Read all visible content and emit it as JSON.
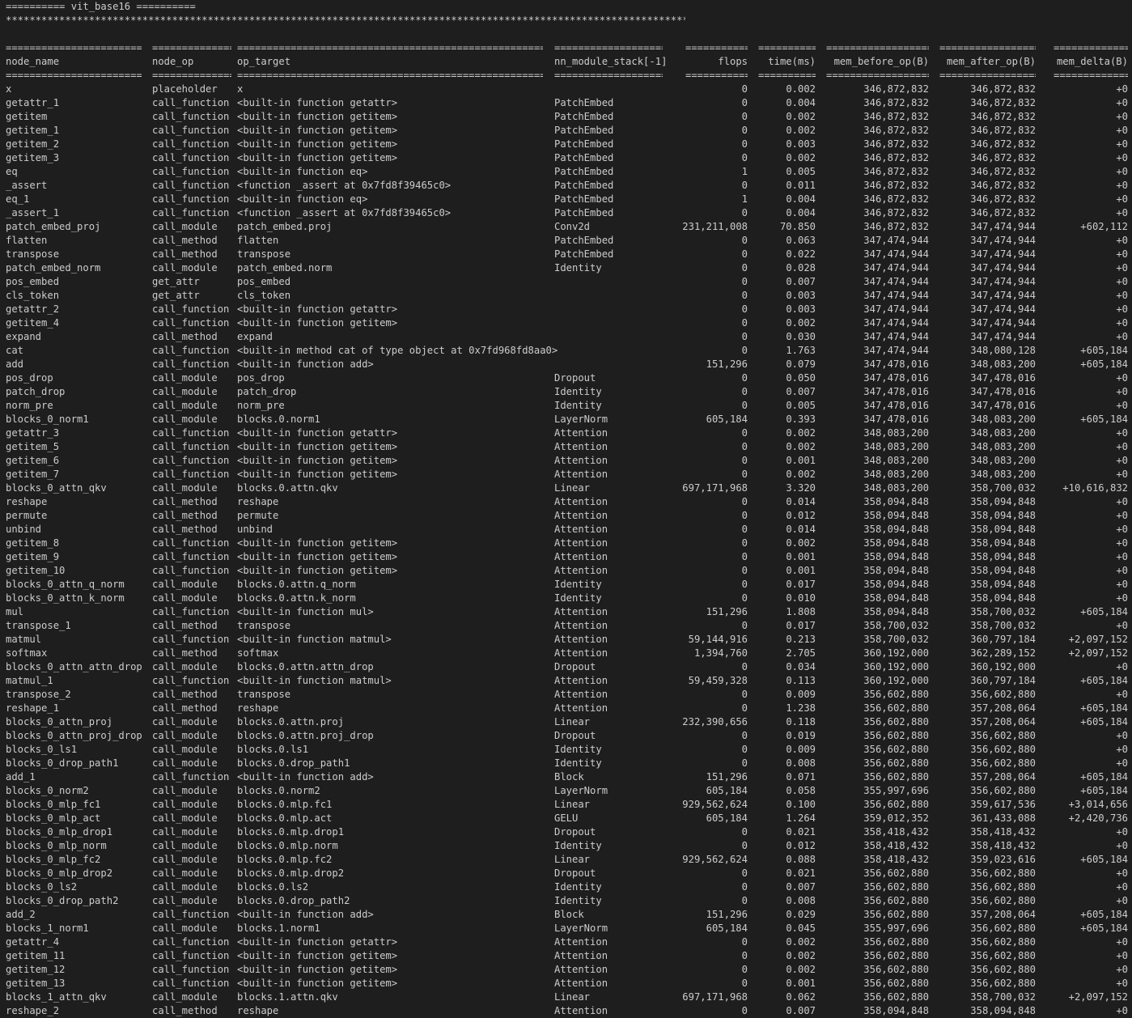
{
  "terminal": {
    "banner": "========== vit_base16 ==========",
    "stars": "*****************************************************************************************************************************************************************************************************"
  },
  "table": {
    "columns": [
      "node_name",
      "node_op",
      "op_target",
      "nn_module_stack[-1]",
      "flops",
      "time(ms)",
      "mem_before_op(B)",
      "mem_after_op(B)",
      "mem_delta(B)"
    ],
    "rows": [
      [
        "x",
        "placeholder",
        "x",
        "",
        "0",
        "0.002",
        "346,872,832",
        "346,872,832",
        "+0"
      ],
      [
        "getattr_1",
        "call_function",
        "<built-in function getattr>",
        "PatchEmbed",
        "0",
        "0.004",
        "346,872,832",
        "346,872,832",
        "+0"
      ],
      [
        "getitem",
        "call_function",
        "<built-in function getitem>",
        "PatchEmbed",
        "0",
        "0.002",
        "346,872,832",
        "346,872,832",
        "+0"
      ],
      [
        "getitem_1",
        "call_function",
        "<built-in function getitem>",
        "PatchEmbed",
        "0",
        "0.002",
        "346,872,832",
        "346,872,832",
        "+0"
      ],
      [
        "getitem_2",
        "call_function",
        "<built-in function getitem>",
        "PatchEmbed",
        "0",
        "0.003",
        "346,872,832",
        "346,872,832",
        "+0"
      ],
      [
        "getitem_3",
        "call_function",
        "<built-in function getitem>",
        "PatchEmbed",
        "0",
        "0.002",
        "346,872,832",
        "346,872,832",
        "+0"
      ],
      [
        "eq",
        "call_function",
        "<built-in function eq>",
        "PatchEmbed",
        "1",
        "0.005",
        "346,872,832",
        "346,872,832",
        "+0"
      ],
      [
        "_assert",
        "call_function",
        "<function _assert at 0x7fd8f39465c0>",
        "PatchEmbed",
        "0",
        "0.011",
        "346,872,832",
        "346,872,832",
        "+0"
      ],
      [
        "eq_1",
        "call_function",
        "<built-in function eq>",
        "PatchEmbed",
        "1",
        "0.004",
        "346,872,832",
        "346,872,832",
        "+0"
      ],
      [
        "_assert_1",
        "call_function",
        "<function _assert at 0x7fd8f39465c0>",
        "PatchEmbed",
        "0",
        "0.004",
        "346,872,832",
        "346,872,832",
        "+0"
      ],
      [
        "patch_embed_proj",
        "call_module",
        "patch_embed.proj",
        "Conv2d",
        "231,211,008",
        "70.850",
        "346,872,832",
        "347,474,944",
        "+602,112"
      ],
      [
        "flatten",
        "call_method",
        "flatten",
        "PatchEmbed",
        "0",
        "0.063",
        "347,474,944",
        "347,474,944",
        "+0"
      ],
      [
        "transpose",
        "call_method",
        "transpose",
        "PatchEmbed",
        "0",
        "0.022",
        "347,474,944",
        "347,474,944",
        "+0"
      ],
      [
        "patch_embed_norm",
        "call_module",
        "patch_embed.norm",
        "Identity",
        "0",
        "0.028",
        "347,474,944",
        "347,474,944",
        "+0"
      ],
      [
        "pos_embed",
        "get_attr",
        "pos_embed",
        "",
        "0",
        "0.007",
        "347,474,944",
        "347,474,944",
        "+0"
      ],
      [
        "cls_token",
        "get_attr",
        "cls_token",
        "",
        "0",
        "0.003",
        "347,474,944",
        "347,474,944",
        "+0"
      ],
      [
        "getattr_2",
        "call_function",
        "<built-in function getattr>",
        "",
        "0",
        "0.003",
        "347,474,944",
        "347,474,944",
        "+0"
      ],
      [
        "getitem_4",
        "call_function",
        "<built-in function getitem>",
        "",
        "0",
        "0.002",
        "347,474,944",
        "347,474,944",
        "+0"
      ],
      [
        "expand",
        "call_method",
        "expand",
        "",
        "0",
        "0.030",
        "347,474,944",
        "347,474,944",
        "+0"
      ],
      [
        "cat",
        "call_function",
        "<built-in method cat of type object at 0x7fd968fd8aa0>",
        "",
        "0",
        "1.763",
        "347,474,944",
        "348,080,128",
        "+605,184"
      ],
      [
        "add",
        "call_function",
        "<built-in function add>",
        "",
        "151,296",
        "0.079",
        "347,478,016",
        "348,083,200",
        "+605,184"
      ],
      [
        "pos_drop",
        "call_module",
        "pos_drop",
        "Dropout",
        "0",
        "0.050",
        "347,478,016",
        "347,478,016",
        "+0"
      ],
      [
        "patch_drop",
        "call_module",
        "patch_drop",
        "Identity",
        "0",
        "0.007",
        "347,478,016",
        "347,478,016",
        "+0"
      ],
      [
        "norm_pre",
        "call_module",
        "norm_pre",
        "Identity",
        "0",
        "0.005",
        "347,478,016",
        "347,478,016",
        "+0"
      ],
      [
        "blocks_0_norm1",
        "call_module",
        "blocks.0.norm1",
        "LayerNorm",
        "605,184",
        "0.393",
        "347,478,016",
        "348,083,200",
        "+605,184"
      ],
      [
        "getattr_3",
        "call_function",
        "<built-in function getattr>",
        "Attention",
        "0",
        "0.002",
        "348,083,200",
        "348,083,200",
        "+0"
      ],
      [
        "getitem_5",
        "call_function",
        "<built-in function getitem>",
        "Attention",
        "0",
        "0.002",
        "348,083,200",
        "348,083,200",
        "+0"
      ],
      [
        "getitem_6",
        "call_function",
        "<built-in function getitem>",
        "Attention",
        "0",
        "0.001",
        "348,083,200",
        "348,083,200",
        "+0"
      ],
      [
        "getitem_7",
        "call_function",
        "<built-in function getitem>",
        "Attention",
        "0",
        "0.002",
        "348,083,200",
        "348,083,200",
        "+0"
      ],
      [
        "blocks_0_attn_qkv",
        "call_module",
        "blocks.0.attn.qkv",
        "Linear",
        "697,171,968",
        "3.320",
        "348,083,200",
        "358,700,032",
        "+10,616,832"
      ],
      [
        "reshape",
        "call_method",
        "reshape",
        "Attention",
        "0",
        "0.014",
        "358,094,848",
        "358,094,848",
        "+0"
      ],
      [
        "permute",
        "call_method",
        "permute",
        "Attention",
        "0",
        "0.012",
        "358,094,848",
        "358,094,848",
        "+0"
      ],
      [
        "unbind",
        "call_method",
        "unbind",
        "Attention",
        "0",
        "0.014",
        "358,094,848",
        "358,094,848",
        "+0"
      ],
      [
        "getitem_8",
        "call_function",
        "<built-in function getitem>",
        "Attention",
        "0",
        "0.002",
        "358,094,848",
        "358,094,848",
        "+0"
      ],
      [
        "getitem_9",
        "call_function",
        "<built-in function getitem>",
        "Attention",
        "0",
        "0.001",
        "358,094,848",
        "358,094,848",
        "+0"
      ],
      [
        "getitem_10",
        "call_function",
        "<built-in function getitem>",
        "Attention",
        "0",
        "0.001",
        "358,094,848",
        "358,094,848",
        "+0"
      ],
      [
        "blocks_0_attn_q_norm",
        "call_module",
        "blocks.0.attn.q_norm",
        "Identity",
        "0",
        "0.017",
        "358,094,848",
        "358,094,848",
        "+0"
      ],
      [
        "blocks_0_attn_k_norm",
        "call_module",
        "blocks.0.attn.k_norm",
        "Identity",
        "0",
        "0.010",
        "358,094,848",
        "358,094,848",
        "+0"
      ],
      [
        "mul",
        "call_function",
        "<built-in function mul>",
        "Attention",
        "151,296",
        "1.808",
        "358,094,848",
        "358,700,032",
        "+605,184"
      ],
      [
        "transpose_1",
        "call_method",
        "transpose",
        "Attention",
        "0",
        "0.017",
        "358,700,032",
        "358,700,032",
        "+0"
      ],
      [
        "matmul",
        "call_function",
        "<built-in function matmul>",
        "Attention",
        "59,144,916",
        "0.213",
        "358,700,032",
        "360,797,184",
        "+2,097,152"
      ],
      [
        "softmax",
        "call_method",
        "softmax",
        "Attention",
        "1,394,760",
        "2.705",
        "360,192,000",
        "362,289,152",
        "+2,097,152"
      ],
      [
        "blocks_0_attn_attn_drop",
        "call_module",
        "blocks.0.attn.attn_drop",
        "Dropout",
        "0",
        "0.034",
        "360,192,000",
        "360,192,000",
        "+0"
      ],
      [
        "matmul_1",
        "call_function",
        "<built-in function matmul>",
        "Attention",
        "59,459,328",
        "0.113",
        "360,192,000",
        "360,797,184",
        "+605,184"
      ],
      [
        "transpose_2",
        "call_method",
        "transpose",
        "Attention",
        "0",
        "0.009",
        "356,602,880",
        "356,602,880",
        "+0"
      ],
      [
        "reshape_1",
        "call_method",
        "reshape",
        "Attention",
        "0",
        "1.238",
        "356,602,880",
        "357,208,064",
        "+605,184"
      ],
      [
        "blocks_0_attn_proj",
        "call_module",
        "blocks.0.attn.proj",
        "Linear",
        "232,390,656",
        "0.118",
        "356,602,880",
        "357,208,064",
        "+605,184"
      ],
      [
        "blocks_0_attn_proj_drop",
        "call_module",
        "blocks.0.attn.proj_drop",
        "Dropout",
        "0",
        "0.019",
        "356,602,880",
        "356,602,880",
        "+0"
      ],
      [
        "blocks_0_ls1",
        "call_module",
        "blocks.0.ls1",
        "Identity",
        "0",
        "0.009",
        "356,602,880",
        "356,602,880",
        "+0"
      ],
      [
        "blocks_0_drop_path1",
        "call_module",
        "blocks.0.drop_path1",
        "Identity",
        "0",
        "0.008",
        "356,602,880",
        "356,602,880",
        "+0"
      ],
      [
        "add_1",
        "call_function",
        "<built-in function add>",
        "Block",
        "151,296",
        "0.071",
        "356,602,880",
        "357,208,064",
        "+605,184"
      ],
      [
        "blocks_0_norm2",
        "call_module",
        "blocks.0.norm2",
        "LayerNorm",
        "605,184",
        "0.058",
        "355,997,696",
        "356,602,880",
        "+605,184"
      ],
      [
        "blocks_0_mlp_fc1",
        "call_module",
        "blocks.0.mlp.fc1",
        "Linear",
        "929,562,624",
        "0.100",
        "356,602,880",
        "359,617,536",
        "+3,014,656"
      ],
      [
        "blocks_0_mlp_act",
        "call_module",
        "blocks.0.mlp.act",
        "GELU",
        "605,184",
        "1.264",
        "359,012,352",
        "361,433,088",
        "+2,420,736"
      ],
      [
        "blocks_0_mlp_drop1",
        "call_module",
        "blocks.0.mlp.drop1",
        "Dropout",
        "0",
        "0.021",
        "358,418,432",
        "358,418,432",
        "+0"
      ],
      [
        "blocks_0_mlp_norm",
        "call_module",
        "blocks.0.mlp.norm",
        "Identity",
        "0",
        "0.012",
        "358,418,432",
        "358,418,432",
        "+0"
      ],
      [
        "blocks_0_mlp_fc2",
        "call_module",
        "blocks.0.mlp.fc2",
        "Linear",
        "929,562,624",
        "0.088",
        "358,418,432",
        "359,023,616",
        "+605,184"
      ],
      [
        "blocks_0_mlp_drop2",
        "call_module",
        "blocks.0.mlp.drop2",
        "Dropout",
        "0",
        "0.021",
        "356,602,880",
        "356,602,880",
        "+0"
      ],
      [
        "blocks_0_ls2",
        "call_module",
        "blocks.0.ls2",
        "Identity",
        "0",
        "0.007",
        "356,602,880",
        "356,602,880",
        "+0"
      ],
      [
        "blocks_0_drop_path2",
        "call_module",
        "blocks.0.drop_path2",
        "Identity",
        "0",
        "0.008",
        "356,602,880",
        "356,602,880",
        "+0"
      ],
      [
        "add_2",
        "call_function",
        "<built-in function add>",
        "Block",
        "151,296",
        "0.029",
        "356,602,880",
        "357,208,064",
        "+605,184"
      ],
      [
        "blocks_1_norm1",
        "call_module",
        "blocks.1.norm1",
        "LayerNorm",
        "605,184",
        "0.045",
        "355,997,696",
        "356,602,880",
        "+605,184"
      ],
      [
        "getattr_4",
        "call_function",
        "<built-in function getattr>",
        "Attention",
        "0",
        "0.002",
        "356,602,880",
        "356,602,880",
        "+0"
      ],
      [
        "getitem_11",
        "call_function",
        "<built-in function getitem>",
        "Attention",
        "0",
        "0.002",
        "356,602,880",
        "356,602,880",
        "+0"
      ],
      [
        "getitem_12",
        "call_function",
        "<built-in function getitem>",
        "Attention",
        "0",
        "0.002",
        "356,602,880",
        "356,602,880",
        "+0"
      ],
      [
        "getitem_13",
        "call_function",
        "<built-in function getitem>",
        "Attention",
        "0",
        "0.001",
        "356,602,880",
        "356,602,880",
        "+0"
      ],
      [
        "blocks_1_attn_qkv",
        "call_module",
        "blocks.1.attn.qkv",
        "Linear",
        "697,171,968",
        "0.062",
        "356,602,880",
        "358,700,032",
        "+2,097,152"
      ],
      [
        "reshape_2",
        "call_method",
        "reshape",
        "Attention",
        "0",
        "0.007",
        "358,094,848",
        "358,094,848",
        "+0"
      ]
    ]
  }
}
